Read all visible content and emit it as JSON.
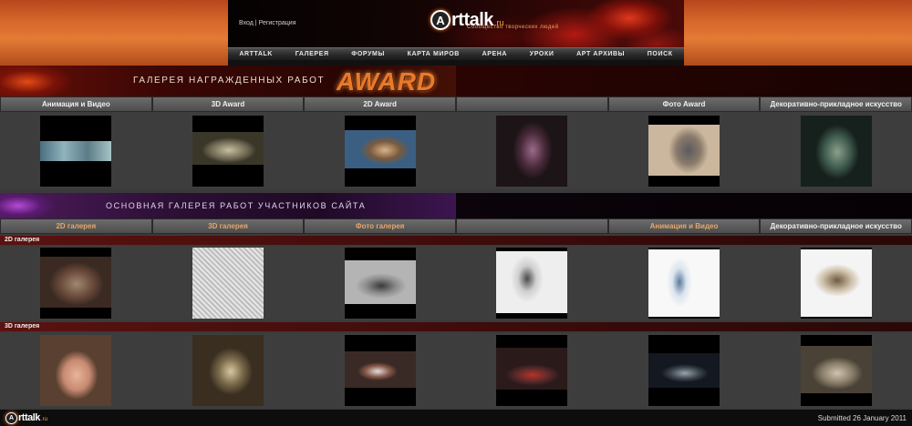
{
  "header": {
    "login": "Вход",
    "separator": "|",
    "register": "Регистрация",
    "logo_letter": "A",
    "logo_text": "rttalk",
    "logo_tld": ".ru",
    "logo_subtitle": "Сообщество творческих людей",
    "nav": [
      "ARTTALK",
      "ГАЛЕРЕЯ",
      "ФОРУМЫ",
      "КАРТА МИРОВ",
      "АРЕНА",
      "УРОКИ",
      "АРТ АРХИВЫ",
      "ПОИСК"
    ]
  },
  "award_banner": {
    "title": "Галерея награжденных работ",
    "word": "AWARD"
  },
  "award_categories": [
    "Анимация и Видео",
    "3D Award",
    "2D Award",
    "Фото Award",
    "Декоративно-прикладное искусство"
  ],
  "main_banner": {
    "title": "Основная галерея работ участников сайта"
  },
  "main_categories": [
    "2D галерея",
    "3D галерея",
    "Фото галерея",
    "Анимация и Видео",
    "Декоративно-прикладное искусство"
  ],
  "sections": {
    "gallery_2d": "2D галерея",
    "gallery_3d": "3D галерея"
  },
  "footer": {
    "logo_letter": "A",
    "logo_text": "rttalk",
    "logo_tld": ".ru",
    "note": "Submitted 26 January 2011"
  },
  "colors": {
    "accent_orange": "#e87a2a",
    "nav_bg": "#2a2a2a",
    "section_bar": "#5a1210"
  }
}
